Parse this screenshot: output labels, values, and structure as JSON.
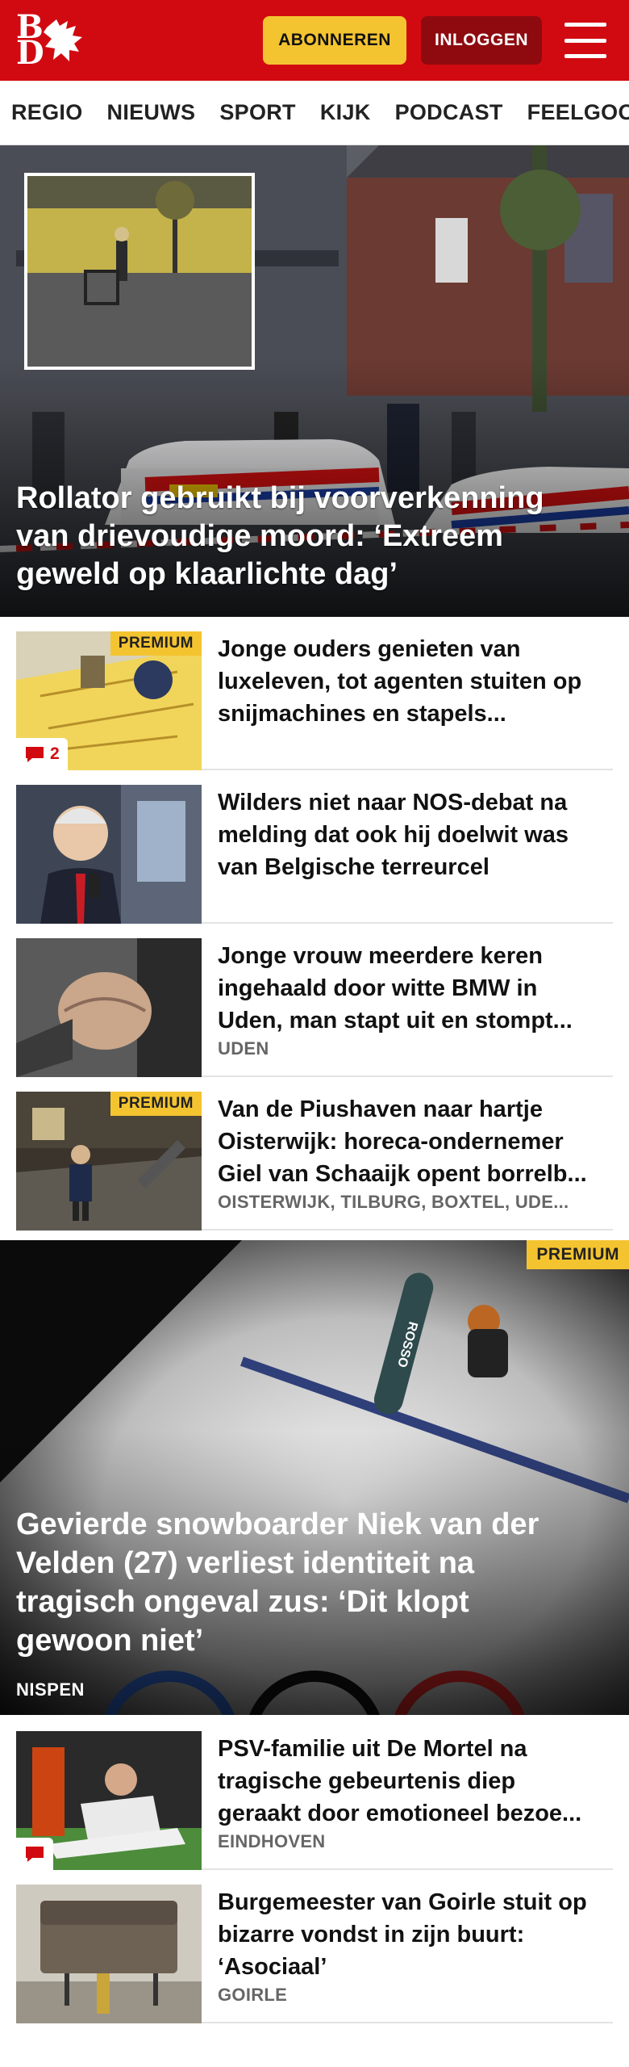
{
  "header": {
    "logo_b": "B",
    "logo_d": "D",
    "subscribe_label": "ABONNEREN",
    "login_label": "INLOGGEN",
    "brand_color": "#d10a11",
    "accent_color": "#f4c430"
  },
  "nav": {
    "items": [
      "REGIO",
      "NIEUWS",
      "SPORT",
      "KIJK",
      "PODCAST",
      "FEELGOOD"
    ]
  },
  "hero": {
    "title": "Rollator gebruikt bij voorverkenning van drievoudige moord: ‘Extreem geweld op klaarlichte dag’"
  },
  "articles": [
    {
      "title": "Jonge ouders genieten van luxeleven, tot agenten stuiten op snijmachines en stapels...",
      "premium": "PREMIUM",
      "comments": "2",
      "tag": ""
    },
    {
      "title": "Wilders niet naar NOS-debat na melding dat ook hij doelwit was van Belgische terreurcel",
      "tag": ""
    },
    {
      "title": "Jonge vrouw meerdere keren ingehaald door witte BMW in Uden, man stapt uit en stompt...",
      "tag": "UDEN"
    },
    {
      "title": "Van de Piushaven naar hartje Oisterwijk: horeca-ondernemer Giel van Schaaijk opent borrelb...",
      "premium": "PREMIUM",
      "tag": "OISTERWIJK, TILBURG, BOXTEL, UDE..."
    }
  ],
  "big_article": {
    "premium": "PREMIUM",
    "title": "Gevierde snowboarder Niek van der Velden (27) verliest identiteit na tragisch ongeval zus: ‘Dit klopt gewoon niet’",
    "tag": "NISPEN"
  },
  "articles2": [
    {
      "title": "PSV-familie uit De Mortel na tragische gebeurtenis diep geraakt door emotioneel bezoe...",
      "tag": "EINDHOVEN"
    },
    {
      "title": "Burgemeester van Goirle stuit op bizarre vondst in zijn buurt: ‘Asociaal’",
      "tag": "GOIRLE"
    }
  ]
}
